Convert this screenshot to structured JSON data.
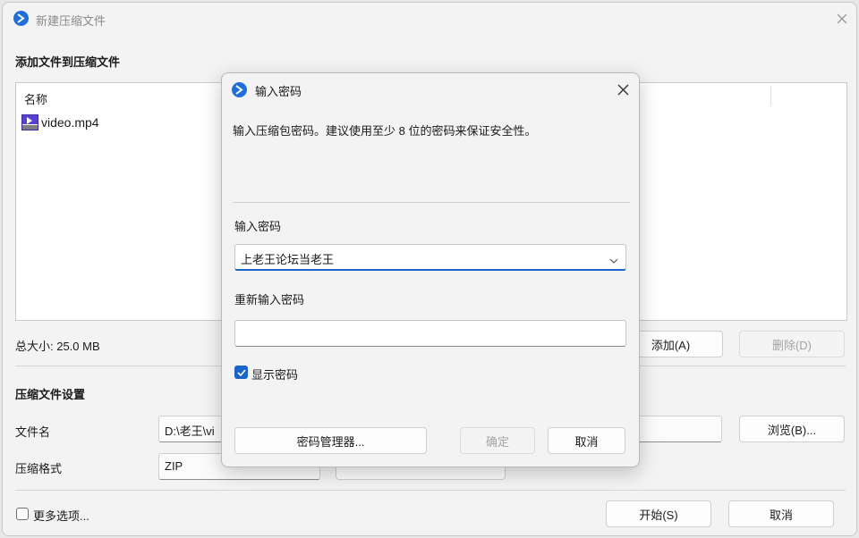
{
  "main_window": {
    "title": "新建压缩文件",
    "add_files_heading": "添加文件到压缩文件",
    "file_list": {
      "column_header": "名称",
      "files": [
        {
          "name": "video.mp4"
        }
      ]
    },
    "total_size": "总大小: 25.0 MB",
    "add_button": "添加(A)",
    "delete_button": "删除(D)",
    "settings_heading": "压缩文件设置",
    "filename_label": "文件名",
    "filename_value": "D:\\老王\\vi",
    "browse_button": "浏览(B)...",
    "format_label": "压缩格式",
    "format_value": "ZIP",
    "more_options_label": "更多选项...",
    "start_button": "开始(S)",
    "cancel_button": "取消"
  },
  "password_dialog": {
    "title": "输入密码",
    "description": "输入压缩包密码。建议使用至少 8 位的密码来保证安全性。",
    "password_label": "输入密码",
    "password_value": "上老王论坛当老王",
    "reenter_label": "重新输入密码",
    "reenter_value": "",
    "show_password_label": "显示密码",
    "show_password_checked": true,
    "password_manager_button": "密码管理器...",
    "ok_button": "确定",
    "cancel_button": "取消"
  },
  "colors": {
    "accent": "#1b64c8",
    "window_bg": "#f3f3f3",
    "disabled_text": "#a3a3a3"
  },
  "icons": [
    "app-logo-icon",
    "close-icon",
    "video-file-icon",
    "chevron-down-icon",
    "checkmark-icon"
  ]
}
